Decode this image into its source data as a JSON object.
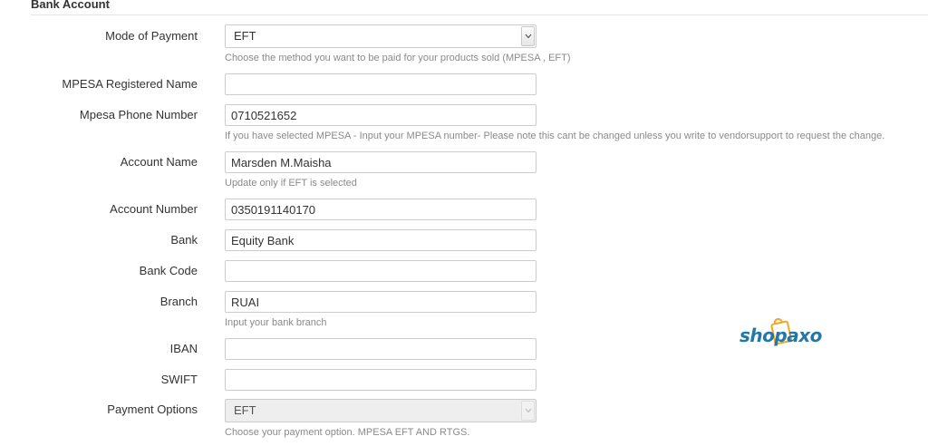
{
  "section": {
    "title": "Bank Account"
  },
  "fields": {
    "mode_of_payment": {
      "label": "Mode of Payment",
      "value": "EFT",
      "help": "Choose the method you want to be paid for your products sold (MPESA , EFT)"
    },
    "mpesa_registered_name": {
      "label": "MPESA Registered Name",
      "value": ""
    },
    "mpesa_phone_number": {
      "label": "Mpesa Phone Number",
      "value": "0710521652",
      "help": "If you have selected MPESA - Input your MPESA number- Please note this cant be changed unless you write to vendorsupport to request the change."
    },
    "account_name": {
      "label": "Account Name",
      "value": "Marsden M.Maisha",
      "help": "Update only if EFT is selected"
    },
    "account_number": {
      "label": "Account Number",
      "value": "0350191140170"
    },
    "bank": {
      "label": "Bank",
      "value": "Equity Bank"
    },
    "bank_code": {
      "label": "Bank Code",
      "value": ""
    },
    "branch": {
      "label": "Branch",
      "value": "RUAI",
      "help": "Input your bank branch"
    },
    "iban": {
      "label": "IBAN",
      "value": ""
    },
    "swift": {
      "label": "SWIFT",
      "value": ""
    },
    "payment_options": {
      "label": "Payment Options",
      "value": "EFT",
      "help": "Choose your payment option. MPESA EFT AND RTGS.",
      "disabled": true
    }
  },
  "logo": {
    "text": "shopaxo",
    "colors": {
      "text": "#2378a8",
      "bag": "#f5a623"
    }
  },
  "colors": {
    "border": "#cccccc",
    "help_text": "#8a8a8a",
    "label_text": "#333333"
  }
}
